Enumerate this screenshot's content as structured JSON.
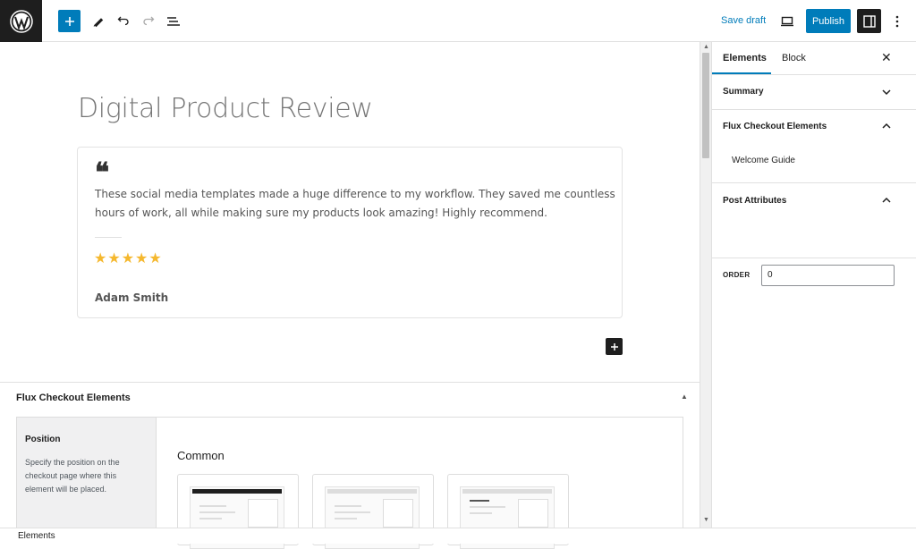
{
  "toolbar": {
    "logo_icon": "wordpress-logo",
    "add_icon": "plus-icon",
    "tools_icon": "pencil-icon",
    "undo_icon": "undo-icon",
    "redo_icon": "redo-icon",
    "outline_icon": "list-view-icon",
    "save_draft_label": "Save draft",
    "preview_icon": "laptop-icon",
    "publish_label": "Publish",
    "settings_icon": "sidebar-icon",
    "options_icon": "kebab-icon"
  },
  "editor": {
    "title": "Digital Product Review",
    "review": {
      "quote_mark": "❝",
      "text": "These social media templates made a huge difference to my workflow. They saved me countless hours of work, all while making sure my products look amazing! Highly recommend.",
      "rating": 5,
      "stars": "★★★★★",
      "author": "Adam Smith"
    }
  },
  "metabox": {
    "title": "Flux Checkout Elements",
    "position_heading": "Position",
    "position_description": "Specify the position on the checkout page where this element will be placed.",
    "common_heading": "Common"
  },
  "sidebar": {
    "tabs": [
      "Elements",
      "Block"
    ],
    "close_icon": "close-icon",
    "sections": {
      "summary": "Summary",
      "flux": "Flux Checkout Elements",
      "welcome_guide": "Welcome Guide",
      "post_attributes": "Post Attributes",
      "order_label": "ORDER",
      "order_value": "0"
    }
  },
  "statusbar": {
    "label": "Elements"
  },
  "colors": {
    "accent": "#007cba",
    "dark": "#1e1e1e",
    "star": "#f5b82e"
  }
}
